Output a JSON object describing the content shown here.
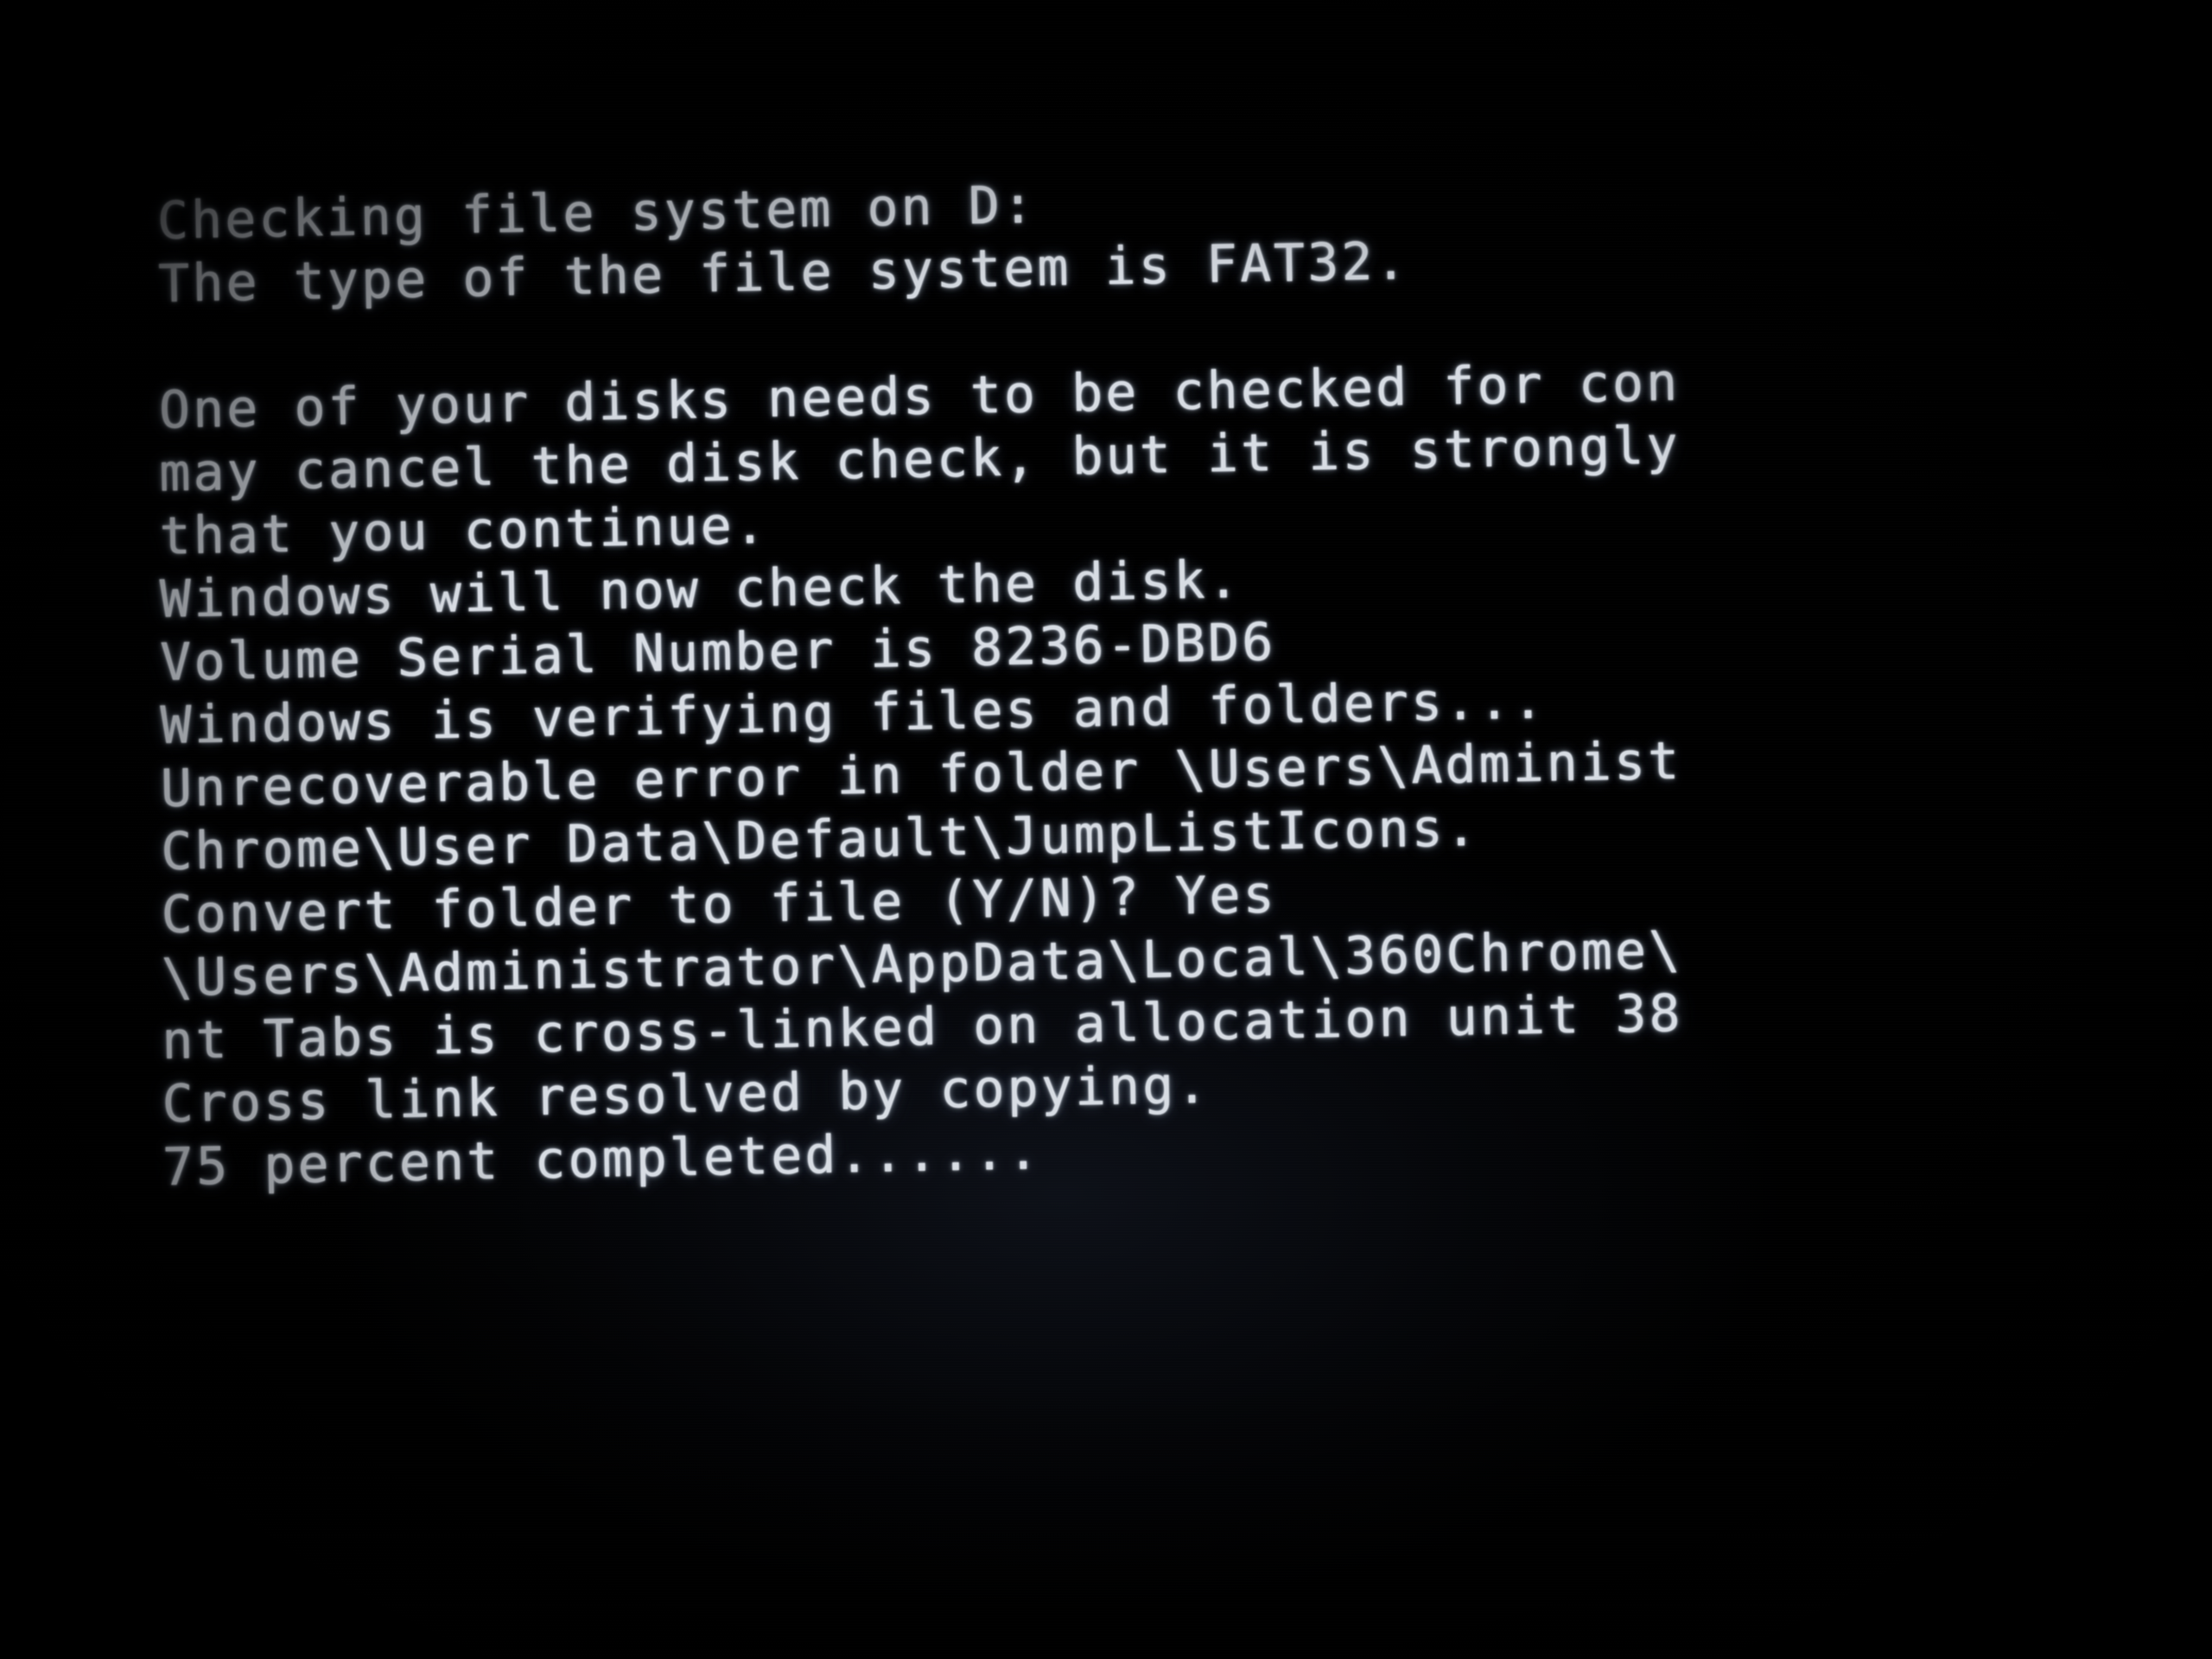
{
  "screen": {
    "kind": "windows-chkdsk-console",
    "background_color": "#000000",
    "text_color": "#d8dde4",
    "note_clipped_right": true
  },
  "console": {
    "drive_letter": "D:",
    "file_system": "FAT32",
    "volume_serial_number": "8236-DBD6",
    "percent_completed": "75",
    "convert_folder_answer": "Yes",
    "lines": [
      "Checking file system on D:",
      "The type of the file system is FAT32.",
      "",
      "One of your disks needs to be checked for con",
      "may cancel the disk check, but it is strongly",
      "that you continue.",
      "Windows will now check the disk.",
      "Volume Serial Number is 8236-DBD6",
      "Windows is verifying files and folders...",
      "Unrecoverable error in folder \\Users\\Administ",
      "Chrome\\User Data\\Default\\JumpListIcons.",
      "Convert folder to file (Y/N)? Yes",
      "\\Users\\Administrator\\AppData\\Local\\360Chrome\\",
      "nt Tabs is cross-linked on allocation unit 38",
      "Cross link resolved by copying.",
      "75 percent completed......"
    ]
  }
}
